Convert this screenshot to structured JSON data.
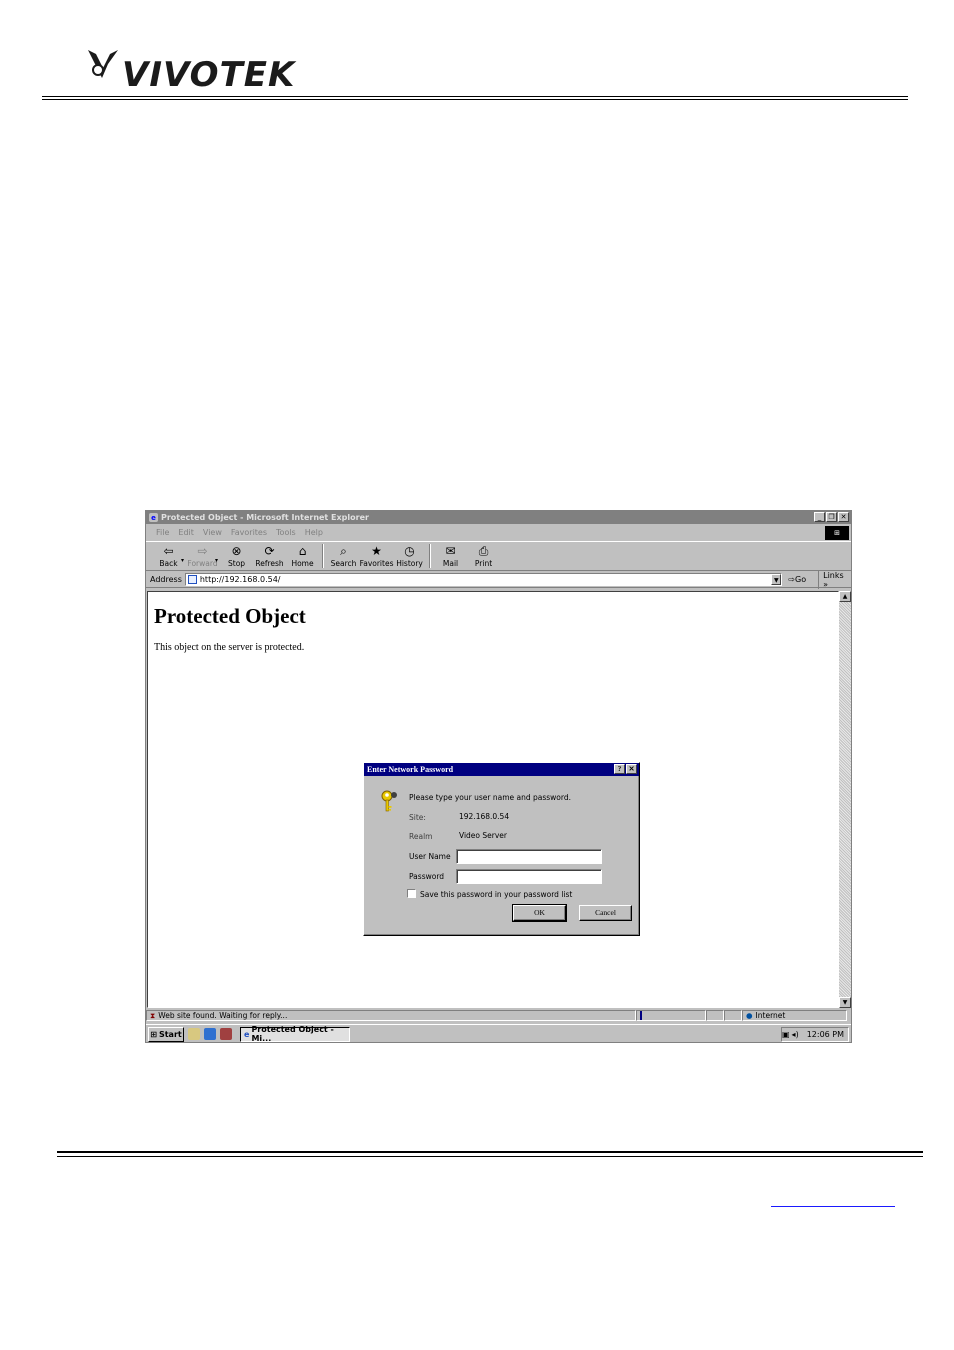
{
  "doc": {
    "logo_text": "VIVOTEK"
  },
  "window": {
    "title": "Protected Object - Microsoft Internet Explorer",
    "menu": [
      "File",
      "Edit",
      "View",
      "Favorites",
      "Tools",
      "Help"
    ],
    "toolbar": [
      {
        "label": "Back",
        "icon": "back-arrow-icon"
      },
      {
        "label": "Forward",
        "icon": "forward-arrow-icon"
      },
      {
        "label": "Stop",
        "icon": "stop-icon"
      },
      {
        "label": "Refresh",
        "icon": "refresh-icon"
      },
      {
        "label": "Home",
        "icon": "home-icon"
      },
      {
        "label": "Search",
        "icon": "search-icon"
      },
      {
        "label": "Favorites",
        "icon": "favorites-icon"
      },
      {
        "label": "History",
        "icon": "history-icon"
      },
      {
        "label": "Mail",
        "icon": "mail-icon"
      },
      {
        "label": "Print",
        "icon": "print-icon"
      }
    ],
    "address_label": "Address",
    "address_value": "http://192.168.0.54/",
    "go_label": "Go",
    "links_label": "Links"
  },
  "page": {
    "heading": "Protected Object",
    "text": "This object on the server is protected."
  },
  "dialog": {
    "title": "Enter Network Password",
    "prompt": "Please type your user name and password.",
    "site_label": "Site:",
    "site_value": "192.168.0.54",
    "realm_label": "Realm",
    "realm_value": "Video Server",
    "username_label": "User Name",
    "username_value": "",
    "password_label": "Password",
    "password_value": "",
    "save_label": "Save this password in your password list",
    "ok_label": "OK",
    "cancel_label": "Cancel"
  },
  "status": {
    "text": "Web site found. Waiting for reply...",
    "zone": "Internet"
  },
  "taskbar": {
    "start_label": "Start",
    "task_label": "Protected Object - Mi...",
    "clock": "12:06 PM"
  }
}
